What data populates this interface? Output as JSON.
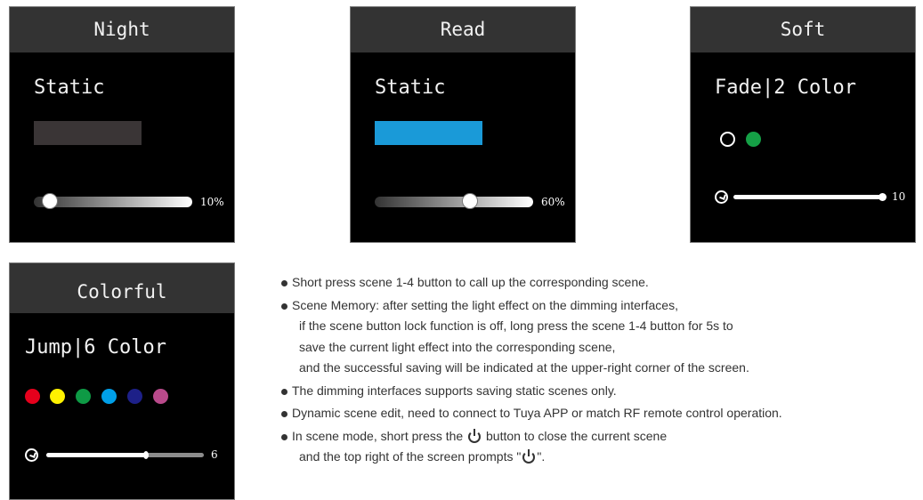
{
  "scenes": [
    {
      "title": "Night",
      "mode": "Static",
      "color": "#3a3536",
      "brightness_percent": 10,
      "value_label": "10%"
    },
    {
      "title": "Read",
      "mode": "Static",
      "color": "#1a9ad8",
      "brightness_percent": 60,
      "value_label": "60%"
    },
    {
      "title": "Soft",
      "mode": "Fade|2 Color",
      "colors": [
        "#000000",
        "#15a046"
      ],
      "speed": 10,
      "value_label": "10",
      "speed_icon": "speed-gauge-icon"
    },
    {
      "title": "Colorful",
      "mode": "Jump|6 Color",
      "colors": [
        "#e5001c",
        "#fff100",
        "#0e9a45",
        "#009fe8",
        "#1d2088",
        "#b94a8b"
      ],
      "speed": 6,
      "value_label": "6",
      "speed_icon": "speed-gauge-icon"
    }
  ],
  "notes": [
    {
      "lines": [
        "Short press scene 1-4 button to call up the corresponding scene."
      ]
    },
    {
      "lines": [
        "Scene Memory: after setting the light effect on the dimming interfaces,",
        "if the scene button lock function is off, long press the scene 1-4 button for 5s to",
        "save the current light effect into the corresponding scene,",
        "and the successful saving will be indicated at the upper-right corner of the screen."
      ]
    },
    {
      "lines": [
        "The dimming interfaces supports saving static scenes only."
      ]
    },
    {
      "lines": [
        "Dynamic scene edit, need to connect to Tuya APP or match RF remote control operation."
      ]
    },
    {
      "power_line": {
        "before": "In scene mode, short press the",
        "after": "button to close the current scene",
        "icon": "power-icon"
      },
      "lines": [
        "and the top right of the screen prompts \""
      ],
      "tail": "\"."
    }
  ]
}
